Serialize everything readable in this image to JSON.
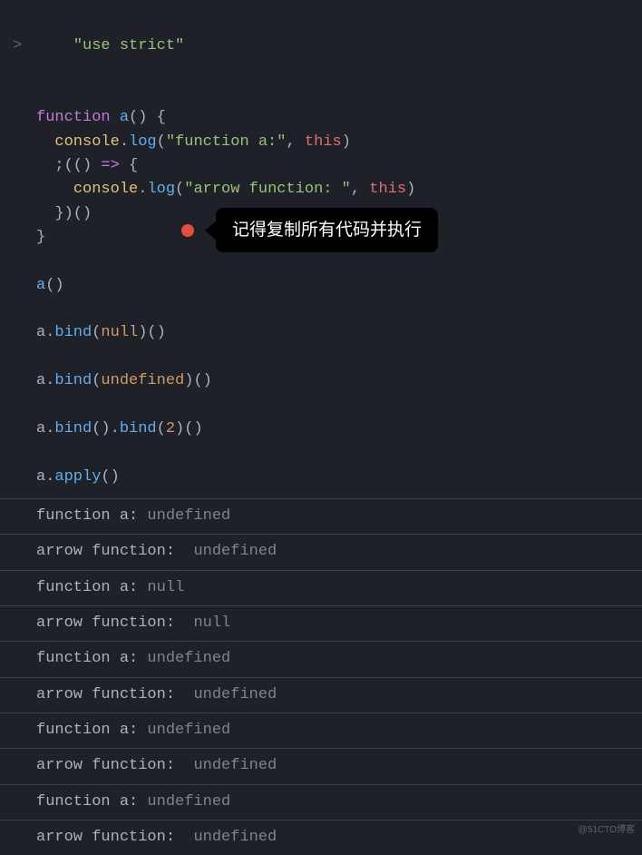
{
  "code": {
    "gutter": ">",
    "l1_str": "\"use strict\"",
    "l3_kw": "function",
    "l3_name": "a",
    "l3_paren": "() {",
    "l4_obj": "console",
    "l4_dot": ".",
    "l4_method": "log",
    "l4_open": "(",
    "l4_str": "\"function a:\"",
    "l4_comma": ", ",
    "l4_this": "this",
    "l4_close": ")",
    "l5_start": ";(() ",
    "l5_arrow": "=>",
    "l5_brace": " {",
    "l6_obj": "console",
    "l6_dot": ".",
    "l6_method": "log",
    "l6_open": "(",
    "l6_str": "\"arrow function: \"",
    "l6_comma": ", ",
    "l6_this": "this",
    "l6_close": ")",
    "l7": "})()",
    "l8": "}",
    "l10_name": "a",
    "l10_call": "()",
    "l12_name": "a",
    "l12_dot": ".",
    "l12_bind": "bind",
    "l12_open": "(",
    "l12_arg": "null",
    "l12_close": ")()",
    "l14_name": "a",
    "l14_dot": ".",
    "l14_bind": "bind",
    "l14_open": "(",
    "l14_arg": "undefined",
    "l14_close": ")()",
    "l16_name": "a",
    "l16_dot": ".",
    "l16_bind1": "bind",
    "l16_p1": "().",
    "l16_bind2": "bind",
    "l16_p2": "(",
    "l16_num": "2",
    "l16_p3": ")()",
    "l18_name": "a",
    "l18_dot": ".",
    "l18_apply": "apply",
    "l18_call": "()"
  },
  "tooltip": {
    "text": "记得复制所有代码并执行"
  },
  "output": [
    {
      "label": "function a: ",
      "value": "undefined"
    },
    {
      "label": "arrow function:  ",
      "value": "undefined"
    },
    {
      "label": "function a: ",
      "value": "null"
    },
    {
      "label": "arrow function:  ",
      "value": "null"
    },
    {
      "label": "function a: ",
      "value": "undefined"
    },
    {
      "label": "arrow function:  ",
      "value": "undefined"
    },
    {
      "label": "function a: ",
      "value": "undefined"
    },
    {
      "label": "arrow function:  ",
      "value": "undefined"
    },
    {
      "label": "function a: ",
      "value": "undefined"
    },
    {
      "label": "arrow function:  ",
      "value": "undefined"
    }
  ],
  "watermark": "@51CTO博客"
}
